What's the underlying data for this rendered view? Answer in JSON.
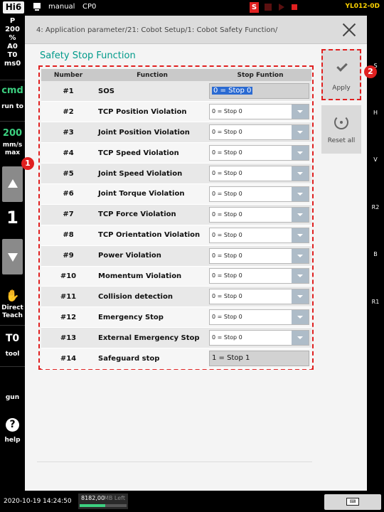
{
  "topbar": {
    "logo": "Hi6",
    "mode": "manual",
    "program": "CP0",
    "s_indicator": "S",
    "controller_id": "YL012-0D"
  },
  "left_sidebar": {
    "status_lines": [
      "P",
      "200",
      "%",
      "A0",
      "T0",
      "ms0"
    ],
    "cmd_label": "cmd",
    "run_to_label": "run to",
    "speed_value": "200",
    "speed_unit_line1": "mm/s",
    "speed_unit_line2": "max",
    "step_number": "1",
    "direct_teach_line1": "Direct",
    "direct_teach_line2": "Teach",
    "tool_value": "T0",
    "tool_label": "tool",
    "gun_label": "gun",
    "help_label": "help"
  },
  "right_sidebar": {
    "labels": [
      "S",
      "H",
      "V",
      "R2",
      "B",
      "R1"
    ]
  },
  "header": {
    "breadcrumb": "4: Application parameter/21: Cobot Setup/1: Cobot Safety Function/"
  },
  "main": {
    "section_title": "Safety Stop Function",
    "table": {
      "headers": [
        "Number",
        "Function",
        "Stop Funtion"
      ],
      "rows": [
        {
          "number": "#1",
          "function": "SOS",
          "stop": "0 = Stop 0",
          "kind": "fixed-selected"
        },
        {
          "number": "#2",
          "function": "TCP Position Violation",
          "stop": "0 = Stop 0",
          "kind": "dropdown"
        },
        {
          "number": "#3",
          "function": "Joint Position Violation",
          "stop": "0 = Stop 0",
          "kind": "dropdown"
        },
        {
          "number": "#4",
          "function": "TCP Speed  Violation",
          "stop": "0 = Stop 0",
          "kind": "dropdown"
        },
        {
          "number": "#5",
          "function": "Joint Speed  Violation",
          "stop": "0 = Stop 0",
          "kind": "dropdown"
        },
        {
          "number": "#6",
          "function": "Joint Torque  Violation",
          "stop": "0 = Stop 0",
          "kind": "dropdown"
        },
        {
          "number": "#7",
          "function": "TCP Force  Violation",
          "stop": "0 = Stop 0",
          "kind": "dropdown"
        },
        {
          "number": "#8",
          "function": "TCP Orientation  Violation",
          "stop": "0 = Stop 0",
          "kind": "dropdown"
        },
        {
          "number": "#9",
          "function": "Power  Violation",
          "stop": "0 = Stop 0",
          "kind": "dropdown"
        },
        {
          "number": "#10",
          "function": "Momentum  Violation",
          "stop": "0 = Stop 0",
          "kind": "dropdown"
        },
        {
          "number": "#11",
          "function": "Collision detection",
          "stop": "0 = Stop 0",
          "kind": "dropdown"
        },
        {
          "number": "#12",
          "function": "Emergency Stop",
          "stop": "0 = Stop 0",
          "kind": "dropdown"
        },
        {
          "number": "#13",
          "function": "External Emergency Stop",
          "stop": "0 = Stop 0",
          "kind": "dropdown"
        },
        {
          "number": "#14",
          "function": "Safeguard stop",
          "stop": "1 = Stop 1",
          "kind": "fixed"
        }
      ]
    },
    "apply_label": "Apply",
    "reset_all_label": "Reset all",
    "callout_1": "1",
    "callout_2": "2"
  },
  "statusbar": {
    "datetime": "2020-10-19 14:24:50",
    "memory_value": "8182,00",
    "memory_label": "MB Left",
    "memory_fraction": 0.55
  },
  "colors": {
    "accent_teal": "#009a8a",
    "highlight_red": "#e02020",
    "speed_green": "#3cd080",
    "controller_id_yellow": "#ffd400"
  }
}
